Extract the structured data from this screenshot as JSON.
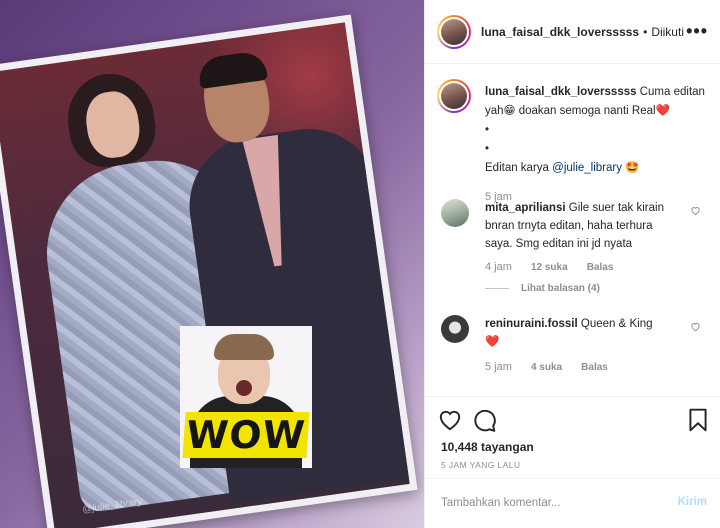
{
  "media": {
    "watermark": "@julie_library",
    "sticker_text": "WOW"
  },
  "post": {
    "username": "luna_faisal_dkk_loversssss",
    "separator": "•",
    "follow_status": "Diikuti",
    "more_icon": "ellipsis-icon"
  },
  "caption": {
    "username": "luna_faisal_dkk_loversssss",
    "text_1": "Cuma editan yah😁 doakan semoga nanti Real❤️",
    "bullet_1": "•",
    "bullet_2": "•",
    "credit_prefix": "Editan karya",
    "credit_mention": "@julie_library",
    "credit_emoji": "🤩",
    "time": "5 jam"
  },
  "comments": [
    {
      "username": "mita_apriliansi",
      "text": "Gile suer tak kirain bnran trnyta editan, haha terhura saya. Smg editan ini jd nyata",
      "time": "4 jam",
      "likes": "12 suka",
      "reply": "Balas",
      "view_replies": "Lihat balasan (4)"
    },
    {
      "username": "reninuraini.fossil",
      "text": "Queen & King",
      "emoji": "❤️",
      "time": "5 jam",
      "likes": "4 suka",
      "reply": "Balas"
    }
  ],
  "stats": {
    "views": "10,448 tayangan",
    "posted": "5 JAM YANG LALU"
  },
  "composer": {
    "placeholder": "Tambahkan komentar...",
    "post_label": "Kirim"
  },
  "colors": {
    "link": "#00376b",
    "muted": "#8e8e8e",
    "post_disabled": "#b2dffc",
    "sticker": "#f1e400"
  }
}
